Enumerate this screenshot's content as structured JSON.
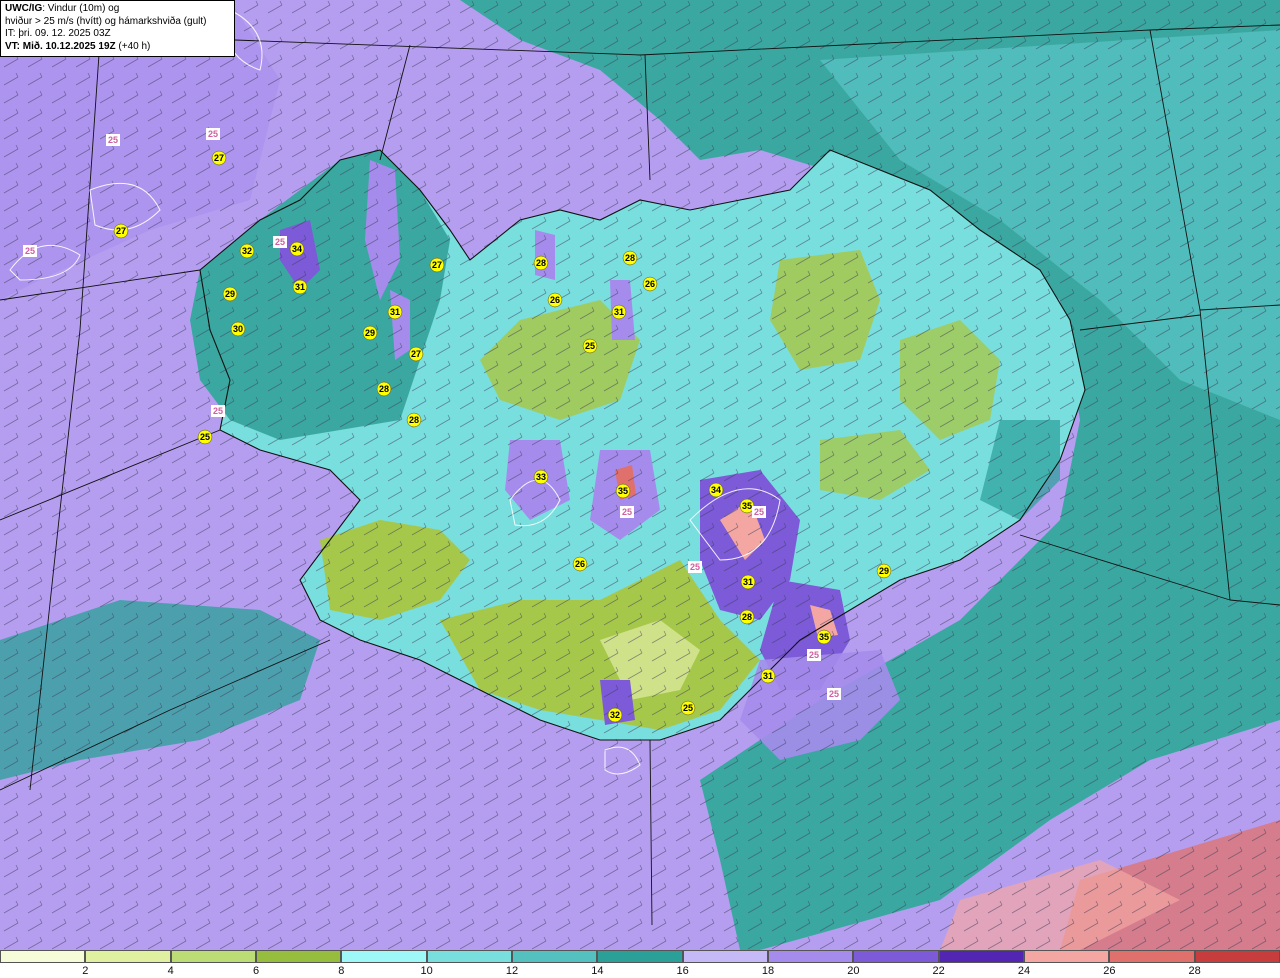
{
  "title": {
    "model": "UWC/IG",
    "line1_rest": ": Vindur (10m) og",
    "line2": "hviður > 25 m/s (hvítt) og hámarkshviða (gult)",
    "line3": "IT: þri. 09. 12. 2025 03Z",
    "line4": "VT: Mið. 10.12.2025 19Z",
    "line4_rest": " (+40 h)"
  },
  "colors": {
    "sea_purple": "#b59ef0",
    "sea_teal": "#3aa8a0",
    "sea_dark_teal": "#2a9288",
    "land_cyan": "#7fe6e6",
    "land_green": "#a6c84a",
    "land_light_green": "#cfe28a",
    "mountain_purple": "#7a5bd8",
    "peak_pink": "#e89a9a",
    "gust_label_yellow": "#ffff00",
    "gust_label_white": "#ffffff"
  },
  "colorbar": {
    "colors": [
      "#f6fbd8",
      "#dff0a0",
      "#bcdc76",
      "#97bd3e",
      "#9ff8f8",
      "#79dede",
      "#55c0c0",
      "#2aa098",
      "#c6b9f7",
      "#a58cec",
      "#7c5ad8",
      "#5226b2",
      "#f4a7a2",
      "#e0706c",
      "#c73c3c"
    ],
    "ticks": [
      "2",
      "4",
      "6",
      "8",
      "10",
      "12",
      "14",
      "16",
      "18",
      "20",
      "22",
      "24",
      "26",
      "28"
    ]
  },
  "gust_labels": [
    {
      "text": "25",
      "style": "white"
    },
    {
      "text": "27",
      "style": "yellow"
    },
    {
      "text": "25",
      "style": "white"
    },
    {
      "text": "27",
      "style": "yellow"
    },
    {
      "text": "25",
      "style": "white"
    },
    {
      "text": "32",
      "style": "yellow"
    },
    {
      "text": "25",
      "style": "white"
    },
    {
      "text": "34",
      "style": "yellow"
    },
    {
      "text": "31",
      "style": "yellow"
    },
    {
      "text": "29",
      "style": "yellow"
    },
    {
      "text": "30",
      "style": "yellow"
    },
    {
      "text": "25",
      "style": "white"
    },
    {
      "text": "27",
      "style": "yellow"
    },
    {
      "text": "31",
      "style": "yellow"
    },
    {
      "text": "29",
      "style": "yellow"
    },
    {
      "text": "27",
      "style": "yellow"
    },
    {
      "text": "28",
      "style": "yellow"
    },
    {
      "text": "28",
      "style": "yellow"
    },
    {
      "text": "25",
      "style": "yellow"
    },
    {
      "text": "28",
      "style": "yellow"
    },
    {
      "text": "26",
      "style": "yellow"
    },
    {
      "text": "28",
      "style": "yellow"
    },
    {
      "text": "26",
      "style": "yellow"
    },
    {
      "text": "31",
      "style": "yellow"
    },
    {
      "text": "25",
      "style": "yellow"
    },
    {
      "text": "33",
      "style": "yellow"
    },
    {
      "text": "35",
      "style": "yellow"
    },
    {
      "text": "25",
      "style": "white"
    },
    {
      "text": "26",
      "style": "yellow"
    },
    {
      "text": "34",
      "style": "yellow"
    },
    {
      "text": "35",
      "style": "yellow"
    },
    {
      "text": "25",
      "style": "white"
    },
    {
      "text": "25",
      "style": "white"
    },
    {
      "text": "31",
      "style": "yellow"
    },
    {
      "text": "28",
      "style": "yellow"
    },
    {
      "text": "29",
      "style": "yellow"
    },
    {
      "text": "35",
      "style": "yellow"
    },
    {
      "text": "25",
      "style": "white"
    },
    {
      "text": "31",
      "style": "yellow"
    },
    {
      "text": "25",
      "style": "white"
    },
    {
      "text": "32",
      "style": "yellow"
    },
    {
      "text": "25",
      "style": "yellow"
    }
  ]
}
